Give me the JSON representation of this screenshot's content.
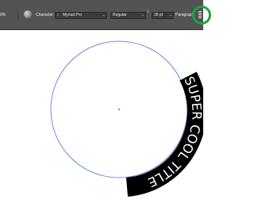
{
  "toolbar": {
    "zoom": "0%",
    "character_label": "Character:",
    "font_family": "Myriad Pro",
    "font_style": "Regular",
    "font_size": "36 pt",
    "paragraph_label": "Paragraph:"
  },
  "artboard": {
    "path_text": "SUPER COOL TITLE",
    "path_color": "#4a6fd6",
    "text_color": "#ffffff",
    "text_bg": "#000000"
  },
  "colors": {
    "toolbar_bg": "#535353",
    "highlight": "#1fa33a"
  }
}
